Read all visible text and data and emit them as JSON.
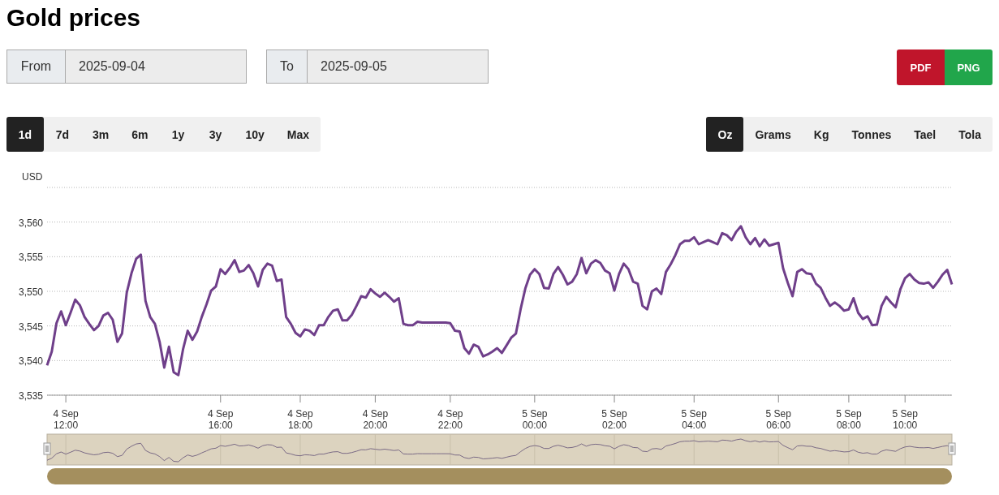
{
  "title": "Gold prices",
  "date_range": {
    "from": {
      "label": "From",
      "value": "2025-09-04"
    },
    "to": {
      "label": "To",
      "value": "2025-09-05"
    }
  },
  "export_buttons": [
    {
      "label": "PDF",
      "color": "#c0152b"
    },
    {
      "label": "PNG",
      "color": "#21a64b"
    }
  ],
  "periods": [
    {
      "label": "1d",
      "selected": true
    },
    {
      "label": "7d",
      "selected": false
    },
    {
      "label": "3m",
      "selected": false
    },
    {
      "label": "6m",
      "selected": false
    },
    {
      "label": "1y",
      "selected": false
    },
    {
      "label": "3y",
      "selected": false
    },
    {
      "label": "10y",
      "selected": false
    },
    {
      "label": "Max",
      "selected": false
    }
  ],
  "units": [
    {
      "label": "Oz",
      "selected": true
    },
    {
      "label": "Grams",
      "selected": false
    },
    {
      "label": "Kg",
      "selected": false
    },
    {
      "label": "Tonnes",
      "selected": false
    },
    {
      "label": "Tael",
      "selected": false
    },
    {
      "label": "Tola",
      "selected": false
    }
  ],
  "chart": {
    "chart_data": {
      "type": "line",
      "ylabel": "USD",
      "categories": [
        null,
        null,
        null,
        null,
        "4 Sep 12:00",
        null,
        null,
        null,
        null,
        null,
        null,
        null,
        null,
        null,
        null,
        null,
        null,
        null,
        null,
        null,
        null,
        null,
        null,
        null,
        null,
        null,
        null,
        null,
        null,
        null,
        null,
        null,
        null,
        null,
        null,
        null,
        null,
        "4 Sep 16:00",
        null,
        null,
        null,
        null,
        null,
        null,
        null,
        null,
        null,
        null,
        null,
        null,
        null,
        null,
        null,
        null,
        "4 Sep 18:00",
        null,
        null,
        null,
        null,
        null,
        null,
        null,
        null,
        null,
        null,
        null,
        null,
        null,
        null,
        null,
        "4 Sep 20:00",
        null,
        null,
        null,
        null,
        null,
        null,
        null,
        null,
        null,
        null,
        null,
        null,
        null,
        null,
        null,
        "4 Sep 22:00",
        null,
        null,
        null,
        null,
        null,
        null,
        null,
        null,
        null,
        null,
        null,
        null,
        null,
        null,
        null,
        null,
        null,
        "5 Sep 00:00",
        null,
        null,
        null,
        null,
        null,
        null,
        null,
        null,
        null,
        null,
        null,
        null,
        null,
        null,
        null,
        null,
        "5 Sep 02:00",
        null,
        null,
        null,
        null,
        null,
        null,
        null,
        null,
        null,
        null,
        null,
        null,
        null,
        null,
        null,
        null,
        "5 Sep 04:00",
        null,
        null,
        null,
        null,
        null,
        null,
        null,
        null,
        null,
        null,
        null,
        null,
        null,
        null,
        null,
        null,
        null,
        "5 Sep 06:00",
        null,
        null,
        null,
        null,
        null,
        null,
        null,
        null,
        null,
        null,
        null,
        null,
        null,
        null,
        "5 Sep 08:00",
        null,
        null,
        null,
        null,
        null,
        null,
        null,
        null,
        null,
        null,
        null,
        "5 Sep 10:00",
        null,
        null,
        null,
        null,
        null,
        null,
        null,
        null,
        null,
        null
      ],
      "series": [
        {
          "color": "#6f3f8a",
          "values": [
            3539.3,
            3541.3,
            3545.4,
            3547.1,
            3545.1,
            3546.9,
            3548.8,
            3548.0,
            3546.3,
            3545.3,
            3544.4,
            3545.0,
            3546.5,
            3546.9,
            3545.9,
            3542.7,
            3543.9,
            3549.8,
            3552.6,
            3554.7,
            3555.3,
            3548.6,
            3546.3,
            3545.3,
            3542.7,
            3539.0,
            3542.0,
            3538.3,
            3537.9,
            3541.6,
            3544.3,
            3543.0,
            3544.2,
            3546.3,
            3548.1,
            3550.1,
            3550.7,
            3553.2,
            3552.5,
            3553.4,
            3554.5,
            3552.8,
            3553.0,
            3553.8,
            3552.6,
            3550.7,
            3553.1,
            3554.0,
            3553.7,
            3551.5,
            3551.7,
            3546.3,
            3545.3,
            3544.0,
            3543.5,
            3544.5,
            3544.3,
            3543.7,
            3545.1,
            3545.1,
            3546.3,
            3547.2,
            3547.4,
            3545.8,
            3545.8,
            3546.6,
            3547.9,
            3549.3,
            3549.1,
            3550.3,
            3549.7,
            3549.2,
            3549.8,
            3549.2,
            3548.5,
            3549.0,
            3545.3,
            3545.1,
            3545.1,
            3545.6,
            3545.5,
            3545.5,
            3545.5,
            3545.5,
            3545.5,
            3545.5,
            3545.4,
            3544.3,
            3544.2,
            3541.8,
            3541.0,
            3542.3,
            3542.0,
            3540.6,
            3540.9,
            3541.3,
            3541.8,
            3541.1,
            3542.2,
            3543.3,
            3543.9,
            3547.4,
            3550.4,
            3552.4,
            3553.2,
            3552.5,
            3550.5,
            3550.4,
            3552.5,
            3553.5,
            3552.4,
            3551.0,
            3551.4,
            3552.5,
            3554.8,
            3552.6,
            3554.0,
            3554.5,
            3554.1,
            3553.0,
            3552.6,
            3550.1,
            3552.5,
            3554.0,
            3553.2,
            3551.4,
            3551.1,
            3547.9,
            3547.4,
            3550.0,
            3550.4,
            3549.6,
            3552.8,
            3553.9,
            3555.2,
            3556.8,
            3557.3,
            3557.3,
            3557.8,
            3556.8,
            3557.1,
            3557.4,
            3557.1,
            3556.8,
            3558.4,
            3558.1,
            3557.4,
            3558.6,
            3559.4,
            3557.8,
            3556.8,
            3557.7,
            3556.5,
            3557.5,
            3556.6,
            3556.8,
            3557.0,
            3553.3,
            3551.2,
            3549.3,
            3552.8,
            3553.2,
            3552.6,
            3552.5,
            3551.1,
            3550.5,
            3549.1,
            3547.9,
            3548.4,
            3547.9,
            3547.2,
            3547.4,
            3549.0,
            3546.9,
            3546.0,
            3546.4,
            3545.1,
            3545.2,
            3547.9,
            3549.2,
            3548.4,
            3547.7,
            3550.3,
            3551.9,
            3552.5,
            3551.7,
            3551.2,
            3551.1,
            3551.3,
            3550.5,
            3551.4,
            3552.4,
            3553.1,
            3551.0
          ]
        }
      ],
      "ylim": [
        3535,
        3565
      ],
      "grid": true,
      "yticks": [
        {
          "value": 3535,
          "label": "3,535"
        },
        {
          "value": 3540,
          "label": "3,540"
        },
        {
          "value": 3545,
          "label": "3,545"
        },
        {
          "value": 3550,
          "label": "3,550"
        },
        {
          "value": 3555,
          "label": "3,555"
        },
        {
          "value": 3560,
          "label": "3,560"
        }
      ]
    }
  }
}
